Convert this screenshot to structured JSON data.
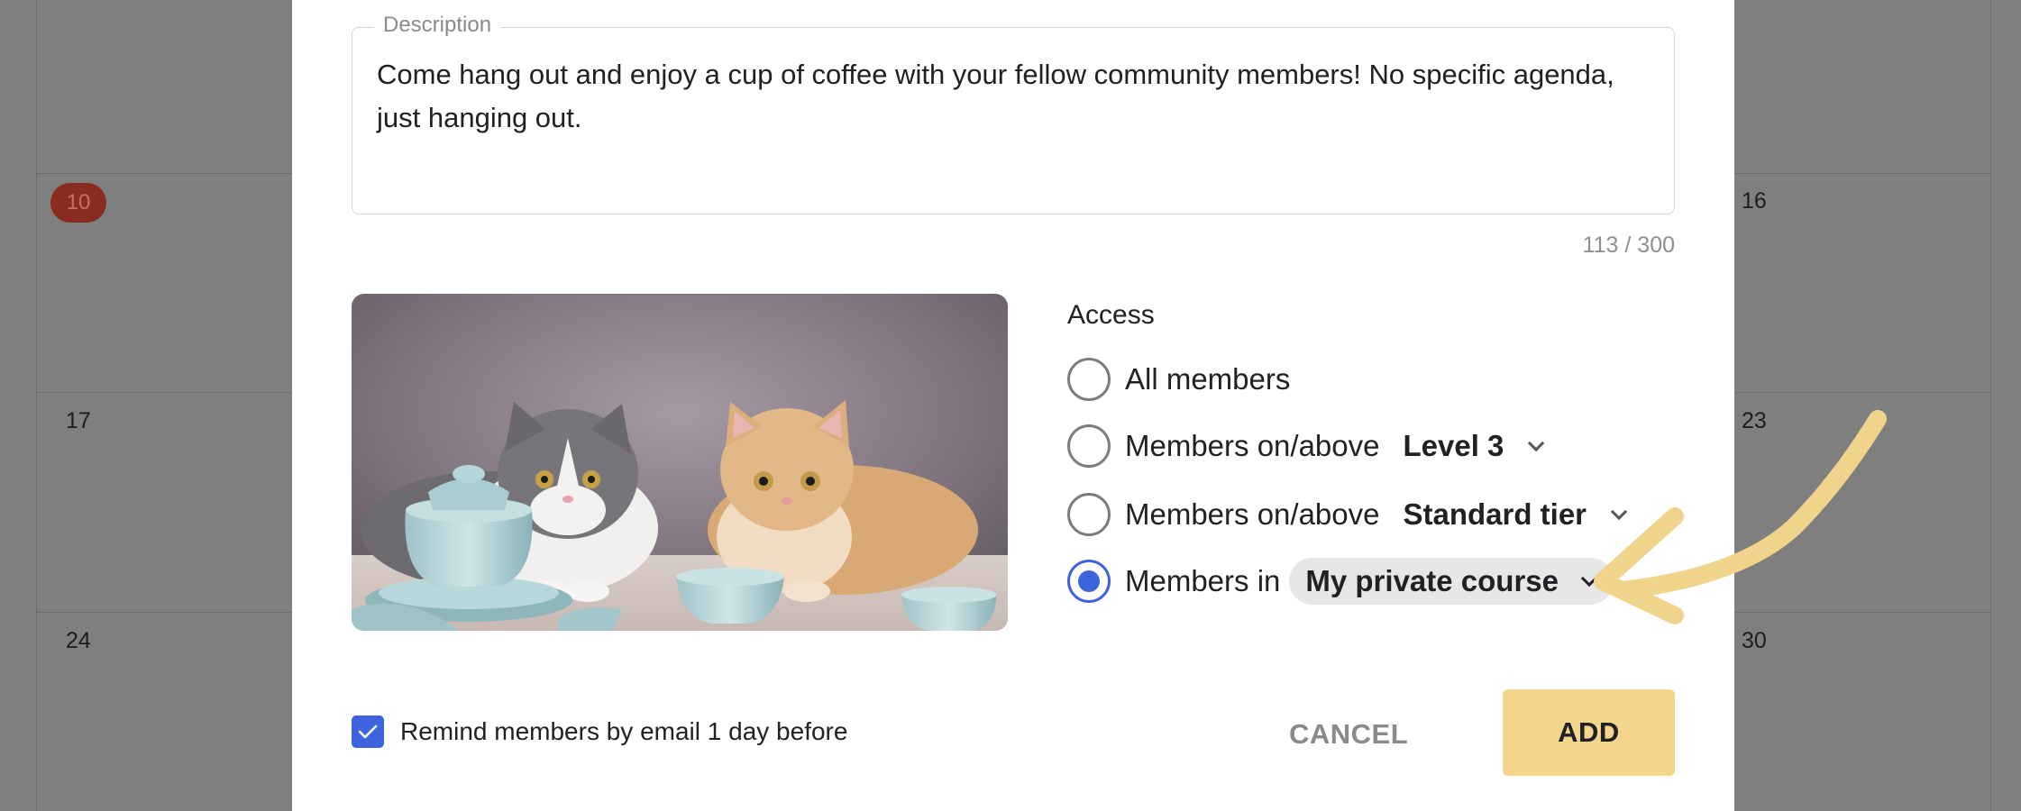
{
  "calendar": {
    "days": [
      {
        "label": "10",
        "today": true
      },
      {
        "label": "16"
      },
      {
        "label": "17"
      },
      {
        "label": "23"
      },
      {
        "label": "24"
      },
      {
        "label": "30"
      }
    ]
  },
  "dialog": {
    "description": {
      "legend": "Description",
      "value": "Come hang out and enjoy a cup of coffee with your fellow community members! No specific agenda, just hanging out.",
      "char_count": "113 / 300"
    },
    "image": {
      "icon": "cats-with-teacups-image"
    },
    "access": {
      "title": "Access",
      "options": [
        {
          "label": "All members",
          "selected": false
        },
        {
          "label": "Members on/above",
          "select_value": "Level 3",
          "selected": false
        },
        {
          "label": "Members on/above",
          "select_value": "Standard tier",
          "selected": false
        },
        {
          "label": "Members in",
          "select_value": "My private course",
          "selected": true
        }
      ]
    },
    "remind": {
      "label": "Remind members by email 1 day before",
      "checked": true
    },
    "buttons": {
      "cancel": "CANCEL",
      "add": "ADD"
    }
  },
  "colors": {
    "accent": "#3d63dd",
    "add_button": "#f3d58c",
    "annotation": "#f1d48b",
    "today_badge": "#8a2b20"
  }
}
